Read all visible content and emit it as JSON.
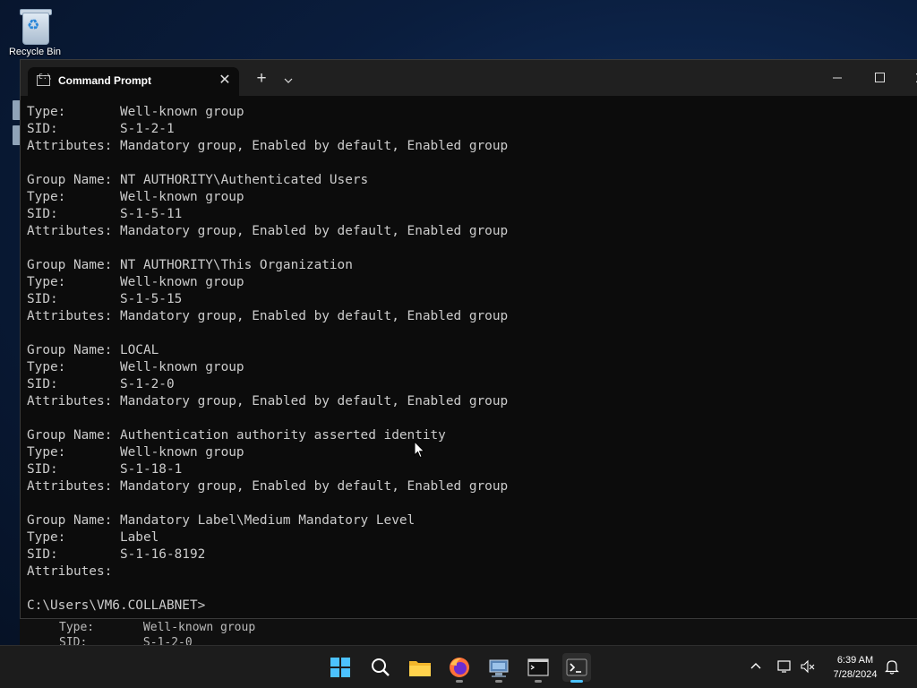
{
  "desktop": {
    "icons": [
      {
        "label": "Recycle Bin"
      }
    ]
  },
  "window": {
    "tab_title": "Command Prompt",
    "new_tab_symbol": "+",
    "close_symbol": "✕"
  },
  "console": {
    "lines": [
      "Type:       Well-known group",
      "SID:        S-1-2-1",
      "Attributes: Mandatory group, Enabled by default, Enabled group",
      "",
      "Group Name: NT AUTHORITY\\Authenticated Users",
      "Type:       Well-known group",
      "SID:        S-1-5-11",
      "Attributes: Mandatory group, Enabled by default, Enabled group",
      "",
      "Group Name: NT AUTHORITY\\This Organization",
      "Type:       Well-known group",
      "SID:        S-1-5-15",
      "Attributes: Mandatory group, Enabled by default, Enabled group",
      "",
      "Group Name: LOCAL",
      "Type:       Well-known group",
      "SID:        S-1-2-0",
      "Attributes: Mandatory group, Enabled by default, Enabled group",
      "",
      "Group Name: Authentication authority asserted identity",
      "Type:       Well-known group",
      "SID:        S-1-18-1",
      "Attributes: Mandatory group, Enabled by default, Enabled group",
      "",
      "Group Name: Mandatory Label\\Medium Mandatory Level",
      "Type:       Label",
      "SID:        S-1-16-8192",
      "Attributes:",
      "",
      "C:\\Users\\VM6.COLLABNET>"
    ]
  },
  "background_console": {
    "lines": [
      "Type:       Well-known group",
      "SID:        S-1-2-0"
    ]
  },
  "taskbar": {
    "items": [
      {
        "icon": "start-icon"
      },
      {
        "icon": "search-icon"
      },
      {
        "icon": "file-explorer-icon"
      },
      {
        "icon": "firefox-icon"
      },
      {
        "icon": "network-tool-icon"
      },
      {
        "icon": "cmd-icon"
      },
      {
        "icon": "terminal-icon"
      }
    ],
    "clock": {
      "time": "6:39 AM",
      "date": "7/28/2024"
    }
  },
  "colors": {
    "terminal_bg": "#0c0c0c",
    "terminal_text": "#cccccc",
    "titlebar_bg": "#202020",
    "taskbar_bg": "#1c1c1c",
    "accent": "#4cc2ff"
  }
}
